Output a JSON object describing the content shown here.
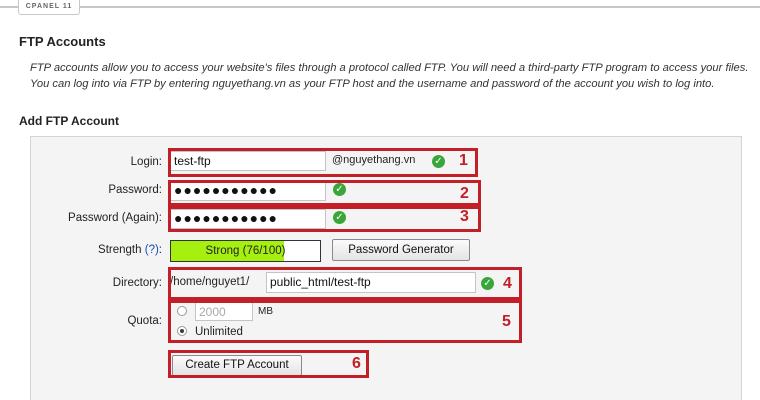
{
  "header": {
    "tab_label": "CPANEL 11"
  },
  "page": {
    "title": "FTP Accounts",
    "description": "FTP accounts allow you to access your website's files through a protocol called FTP. You will need a third-party FTP program to access your files. You can log into via FTP by entering nguyethang.vn as your FTP host and the username and password of the account you wish to log into.",
    "section_title": "Add FTP Account"
  },
  "form": {
    "login": {
      "label": "Login:",
      "value": "test-ftp",
      "domain_suffix": "@nguyethang.vn"
    },
    "password": {
      "label": "Password:",
      "value": "●●●●●●●●●●●"
    },
    "password_again": {
      "label": "Password (Again):",
      "value": "●●●●●●●●●●●"
    },
    "strength": {
      "label": "Strength",
      "help": "(?)",
      "text": "Strong (76/100)",
      "level": 0.76,
      "bar_color": "#a6f010"
    },
    "password_generator_label": "Password Generator",
    "directory": {
      "label": "Directory:",
      "prefix": "/home/nguyet1/",
      "value": "public_html/test-ftp"
    },
    "quota": {
      "label": "Quota:",
      "amount_placeholder": "2000",
      "unit": "MB",
      "unlimited_label": "Unlimited",
      "selected": "unlimited"
    },
    "submit_label": "Create FTP Account"
  },
  "annotations": {
    "n1": "1",
    "n2": "2",
    "n3": "3",
    "n4": "4",
    "n5": "5",
    "n6": "6",
    "color": "#c21f28"
  },
  "status_colors": {
    "valid": "#3aa63a"
  }
}
